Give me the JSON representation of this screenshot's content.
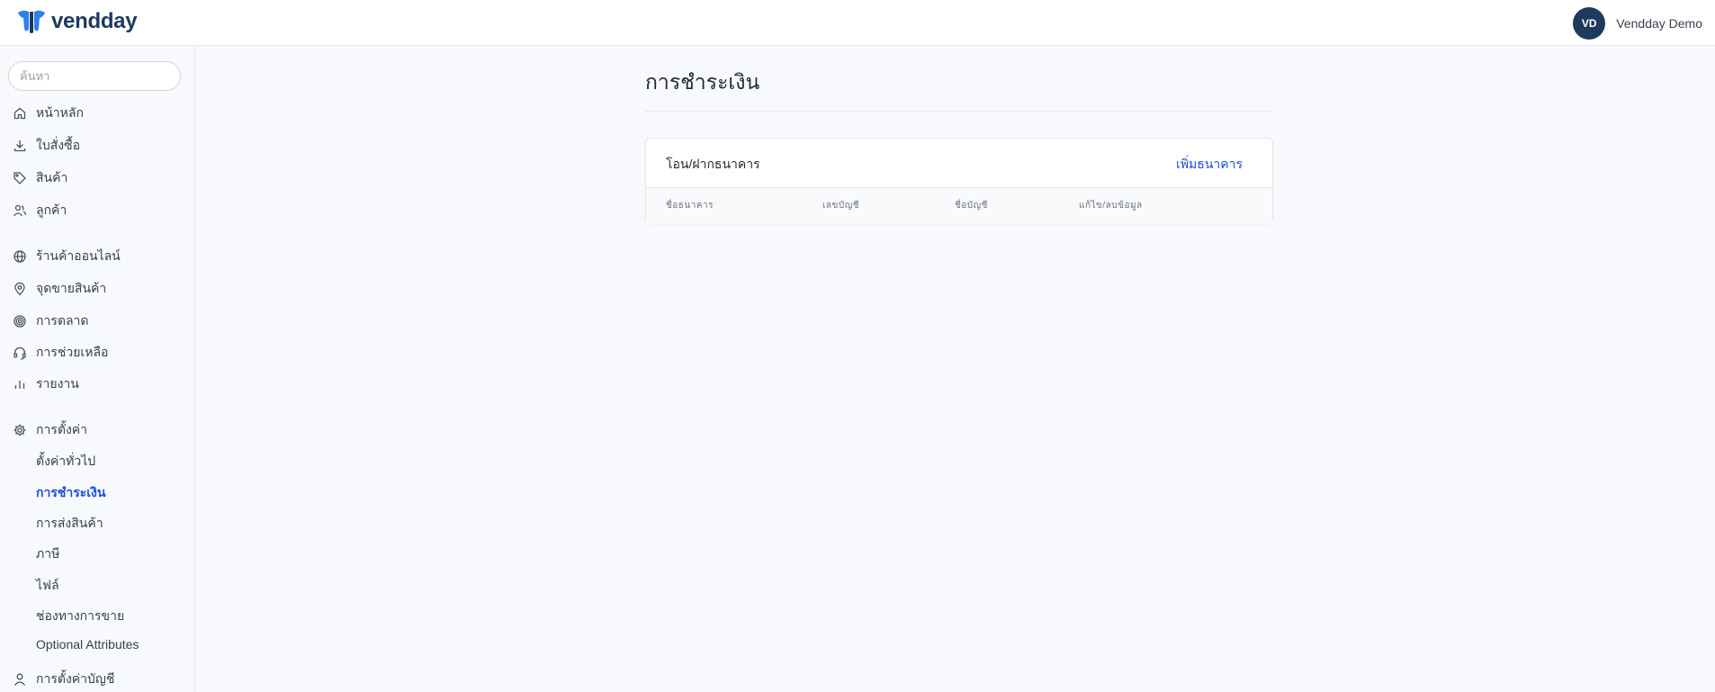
{
  "header": {
    "logo_text": "vendday",
    "brand_color": "#2f80ed",
    "user": {
      "initials": "VD",
      "name": "Vendday Demo"
    }
  },
  "sidebar": {
    "search_placeholder": "ค้นหา",
    "items": [
      {
        "label": "หน้าหลัก",
        "icon": "home-icon"
      },
      {
        "label": "ใบสั่งซื้อ",
        "icon": "download-icon"
      },
      {
        "label": "สินค้า",
        "icon": "tag-icon"
      },
      {
        "label": "ลูกค้า",
        "icon": "users-icon"
      },
      {
        "label": "ร้านค้าออนไลน์",
        "icon": "globe-icon"
      },
      {
        "label": "จุดขายสินค้า",
        "icon": "map-pin-icon"
      },
      {
        "label": "การตลาด",
        "icon": "target-icon"
      },
      {
        "label": "การช่วยเหลือ",
        "icon": "headset-icon"
      },
      {
        "label": "รายงาน",
        "icon": "bar-chart-icon"
      },
      {
        "label": "การตั้งค่า",
        "icon": "gear-icon"
      }
    ],
    "settings_sub": [
      {
        "label": "ตั้งค่าทั่วไป",
        "active": false
      },
      {
        "label": "การชำระเงิน",
        "active": true
      },
      {
        "label": "การส่งสินค้า",
        "active": false
      },
      {
        "label": "ภาษี",
        "active": false
      },
      {
        "label": "ไฟล์",
        "active": false
      },
      {
        "label": "ช่องทางการขาย",
        "active": false
      },
      {
        "label": "Optional Attributes",
        "active": false
      }
    ],
    "account_settings": {
      "label": "การตั้งค่าบัญชี",
      "icon": "user-icon"
    }
  },
  "main": {
    "page_title": "การชำระเงิน",
    "card": {
      "title": "โอน/ฝากธนาคาร",
      "add_bank_label": "เพิ่มธนาคาร",
      "columns": [
        "ชื่อธนาคาร",
        "เลขบัญชี",
        "ชื่อบัญชี",
        "แก้ไข/ลบข้อมูล"
      ]
    }
  },
  "colors": {
    "accent": "#1d4ed8",
    "avatar_bg": "#1e3a5f",
    "page_bg": "#f7f9fc"
  }
}
